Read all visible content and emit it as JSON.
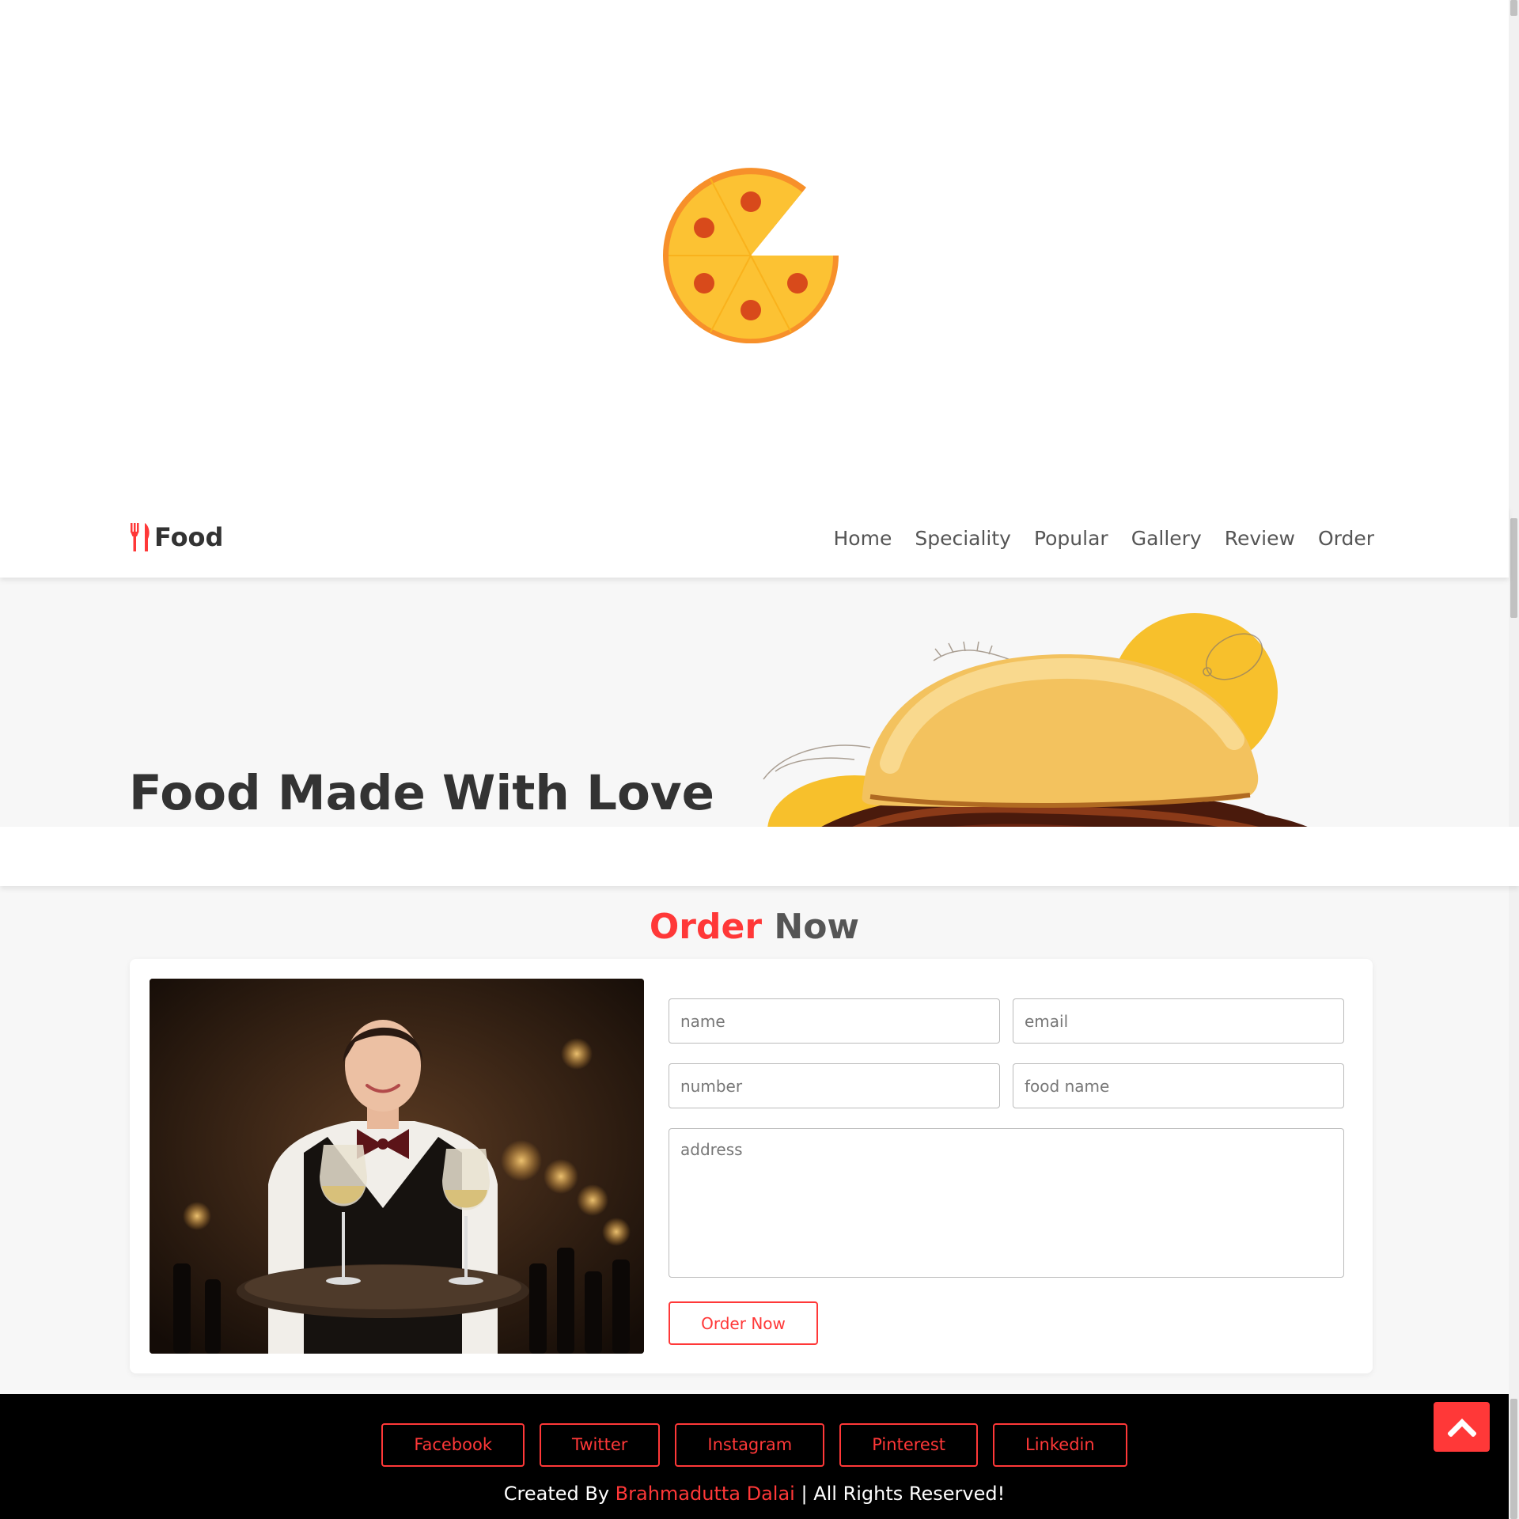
{
  "loader": {
    "icon": "pizza-icon"
  },
  "header": {
    "logo_icon": "utensils-icon",
    "logo_text": "Food",
    "nav": [
      "Home",
      "Speciality",
      "Popular",
      "Gallery",
      "Review",
      "Order"
    ]
  },
  "hero": {
    "title": "Food Made With Love",
    "image": "burger"
  },
  "order": {
    "heading_accent": "Order",
    "heading_rest": "Now",
    "image": "waitress",
    "placeholders": {
      "name": "name",
      "email": "email",
      "number": "number",
      "food": "food name",
      "address": "address"
    },
    "button": "Order Now"
  },
  "footer": {
    "social": [
      "Facebook",
      "Twitter",
      "Instagram",
      "Pinterest",
      "Linkedin"
    ],
    "credit_prefix": "Created By ",
    "credit_author": "Brahmadutta Dalai",
    "credit_suffix": " | All Rights Reserved!"
  },
  "scroll_top_icon": "chevron-up-icon",
  "colors": {
    "accent": "#ff3838",
    "pizza": "#fbc02d",
    "pizza_crust": "#f57f17",
    "pepperoni": "#d84315"
  }
}
